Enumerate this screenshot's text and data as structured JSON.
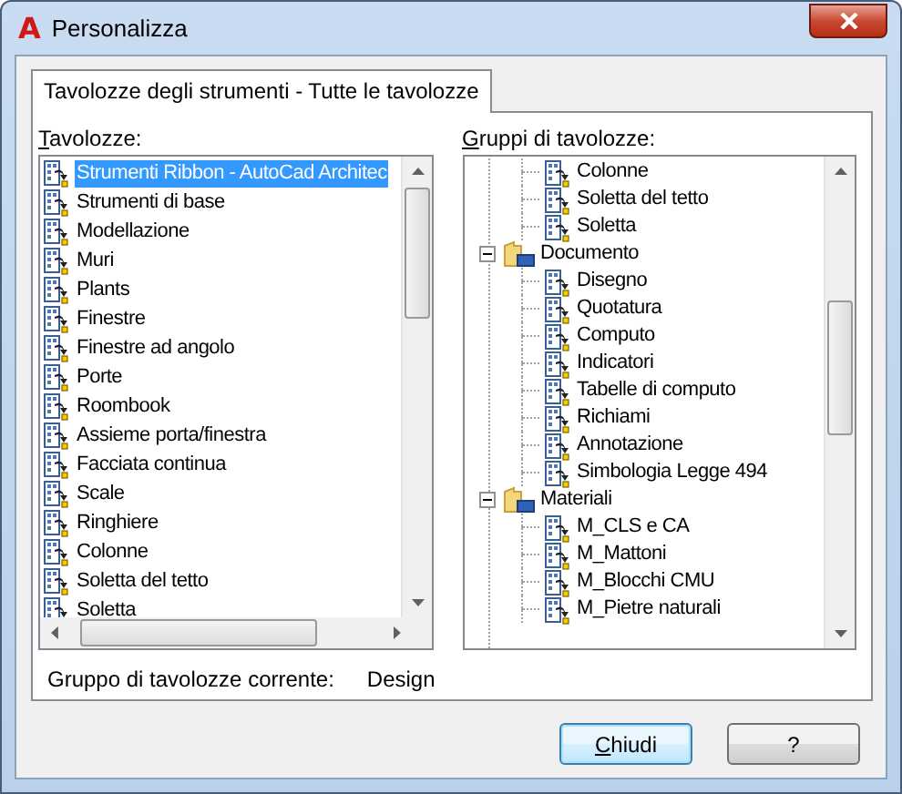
{
  "window": {
    "logo": "A",
    "title": "Personalizza"
  },
  "tabs": [
    {
      "label": "Tavolozze degli strumenti - Tutte le tavolozze",
      "selected": true
    }
  ],
  "palettes": {
    "label": "Tavolozze:",
    "items": [
      {
        "label": "Strumenti Ribbon - AutoCad Architec",
        "selected": true
      },
      {
        "label": "Strumenti di base",
        "selected": false
      },
      {
        "label": "Modellazione",
        "selected": false
      },
      {
        "label": "Muri",
        "selected": false
      },
      {
        "label": "Plants",
        "selected": false
      },
      {
        "label": "Finestre",
        "selected": false
      },
      {
        "label": "Finestre ad angolo",
        "selected": false
      },
      {
        "label": "Porte",
        "selected": false
      },
      {
        "label": "Roombook",
        "selected": false
      },
      {
        "label": "Assieme porta/finestra",
        "selected": false
      },
      {
        "label": "Facciata continua",
        "selected": false
      },
      {
        "label": "Scale",
        "selected": false
      },
      {
        "label": "Ringhiere",
        "selected": false
      },
      {
        "label": "Colonne",
        "selected": false
      },
      {
        "label": "Soletta del tetto",
        "selected": false
      },
      {
        "label": "Soletta",
        "selected": false
      }
    ]
  },
  "groups": {
    "label": "Gruppi di tavolozze:",
    "tree": [
      {
        "kind": "continued",
        "children": [
          {
            "label": "Colonne"
          },
          {
            "label": "Soletta del tetto"
          },
          {
            "label": "Soletta"
          }
        ]
      },
      {
        "kind": "group",
        "label": "Documento",
        "expanded": true,
        "children": [
          {
            "label": "Disegno"
          },
          {
            "label": "Quotatura"
          },
          {
            "label": "Computo"
          },
          {
            "label": "Indicatori"
          },
          {
            "label": "Tabelle di computo"
          },
          {
            "label": "Richiami"
          },
          {
            "label": "Annotazione"
          },
          {
            "label": "Simbologia Legge 494"
          }
        ]
      },
      {
        "kind": "group",
        "label": "Materiali",
        "expanded": true,
        "children": [
          {
            "label": "M_CLS e CA"
          },
          {
            "label": "M_Mattoni"
          },
          {
            "label": "M_Blocchi CMU"
          },
          {
            "label": "M_Pietre naturali"
          }
        ]
      }
    ]
  },
  "current_group": {
    "label": "Gruppo di tavolozze corrente:",
    "value": "Design"
  },
  "buttons": [
    {
      "label": "Chiudi",
      "default": true
    },
    {
      "label": "?",
      "default": false
    }
  ]
}
